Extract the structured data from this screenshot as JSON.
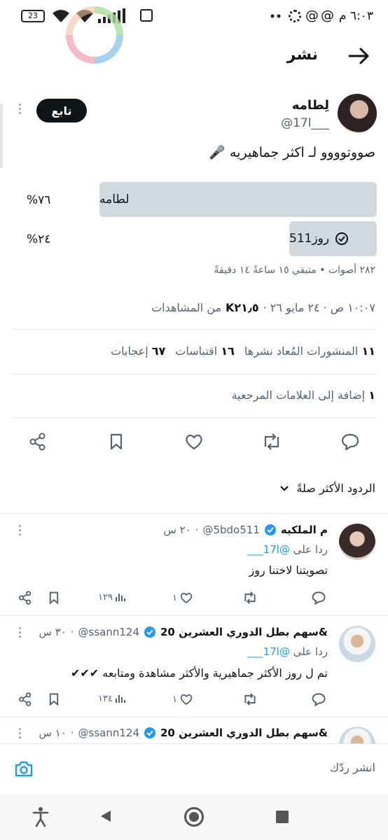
{
  "status_bar": {
    "time": "٦:٠٣ م",
    "battery": "23"
  },
  "header": {
    "title": "نشر"
  },
  "post": {
    "author_name": "لِطامه",
    "handle": "@17l___",
    "follow_label": "تابع",
    "text": "صووتوووو لـ اكثر جماهيريه 🎤",
    "poll": {
      "options": [
        {
          "label": "لطامه",
          "percent": "%٧٦",
          "share": 0.76,
          "selected": false
        },
        {
          "label": "روز511",
          "percent": "%٢٤",
          "share": 0.24,
          "selected": true
        }
      ],
      "summary": "٢٨٢ أصوات • متبقي ١٥ ساعةً ١٤ دقيقةً"
    },
    "meta": {
      "time_date": "١٠:٠٧ ص · ٢٤ مايو ٢٦ ·",
      "views_count": "K٢١٫٥",
      "views_label": "من المشاهدات"
    },
    "stats": {
      "reposts_count": "١١",
      "reposts_label": "المنشورات المُعاد نشرها",
      "quotes_count": "١٦",
      "quotes_label": "اقتباسات",
      "likes_count": "٦٧",
      "likes_label": "إعجابات"
    },
    "bookmarks": {
      "count": "١",
      "label": "إضافة إلى العلامات المرجعية"
    }
  },
  "sort": {
    "label": "الردود الأكثر صلةً"
  },
  "replies": [
    {
      "name": "م الملكيه",
      "handle": "@5bdo511",
      "time": "٢٠ س",
      "replying_to_label": "ردا على",
      "replying_to": "@17l___",
      "text": "تصويتنا لاختنا روز",
      "views": "١٢٩",
      "likes": "١",
      "reposts": "",
      "replies": ""
    },
    {
      "name": "&سهم بطل الدوري العشرين 20",
      "handle": "@ssann124",
      "time": "٣٠ س",
      "replying_to_label": "ردا على",
      "replying_to": "@17l___",
      "text": "تم ل روز الأكثر جماهيرية والأكثر مشاهدة ومتابعه ✔✔✔",
      "views": "١٣٤",
      "likes": "١",
      "reposts": "",
      "replies": ""
    },
    {
      "name": "&سهم بطل الدوري العشرين 20",
      "handle": "@ssann124",
      "time": "١٠ س"
    }
  ],
  "composer": {
    "placeholder": "انشر ردّك"
  },
  "icons": {
    "accent": "#1d9bf0",
    "text": "#0f1419",
    "muted": "#536471"
  }
}
